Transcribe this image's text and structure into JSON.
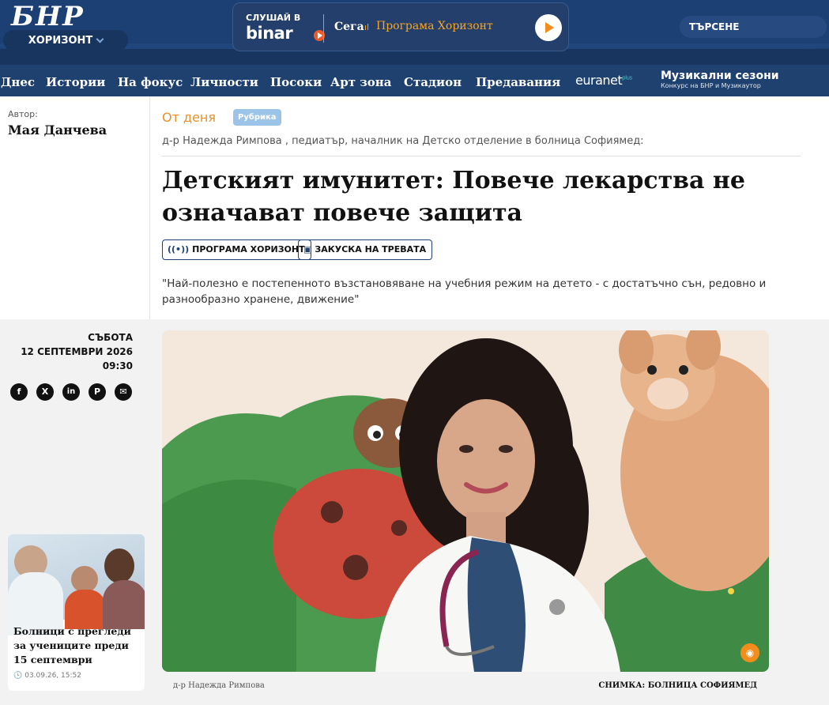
{
  "header": {
    "logo_text": "БНР",
    "station": "ХОРИЗОНТ",
    "player": {
      "listen_label": "СЛУШАЙ В",
      "brand": "binar",
      "now_label": "Сега",
      "program": "Програма Хоризонт"
    },
    "search_label": "ТЪРСЕНЕ"
  },
  "nav": {
    "items": [
      "Днес",
      "Истории",
      "На фокус",
      "Личности",
      "Посоки",
      "Арт зона",
      "Стадион",
      "Предавания"
    ],
    "partner": "euranet",
    "partner_suffix": "plus",
    "promo_title": "Музикални сезони",
    "promo_subtitle": "Конкурс на БНР и Музикаутор"
  },
  "article": {
    "author_label": "Автор:",
    "author_name": "Мая Данчева",
    "category": "От деня",
    "rubric_badge": "Рубрика",
    "subtitle": "д-р Надежда Римпова , педиатър, началник на Детско отделение в болница Софиямед:",
    "title": "Детският имунитет: Повече лекарства не означават повече защита",
    "tags": [
      "ПРОГРАМА ХОРИЗОНТ",
      "ЗАКУСКА НА ТРЕВАТА"
    ],
    "lead": "\"Най-полезно е постепенното възстановяване на учебния режим на детето - с достатъчно сън, редовно и разнообразно хранене, движение\"",
    "date_day": "СЪБОТА",
    "date_full": "12 СЕПТЕМВРИ 2026",
    "time": "09:30",
    "share": [
      "f",
      "X",
      "in",
      "P",
      "✉"
    ],
    "photo_caption": "д-р Надежда Римпова",
    "photo_credit": "СНИМКА: БОЛНИЦА СОФИЯМЕД"
  },
  "related": {
    "title": "Болници с прегледи за учениците преди 15 септември",
    "date": "03.09.26, 15:52"
  },
  "colors": {
    "brand_blue": "#1f4170",
    "accent_orange": "#e8902a",
    "rubric_blue": "#9bc4e8"
  }
}
